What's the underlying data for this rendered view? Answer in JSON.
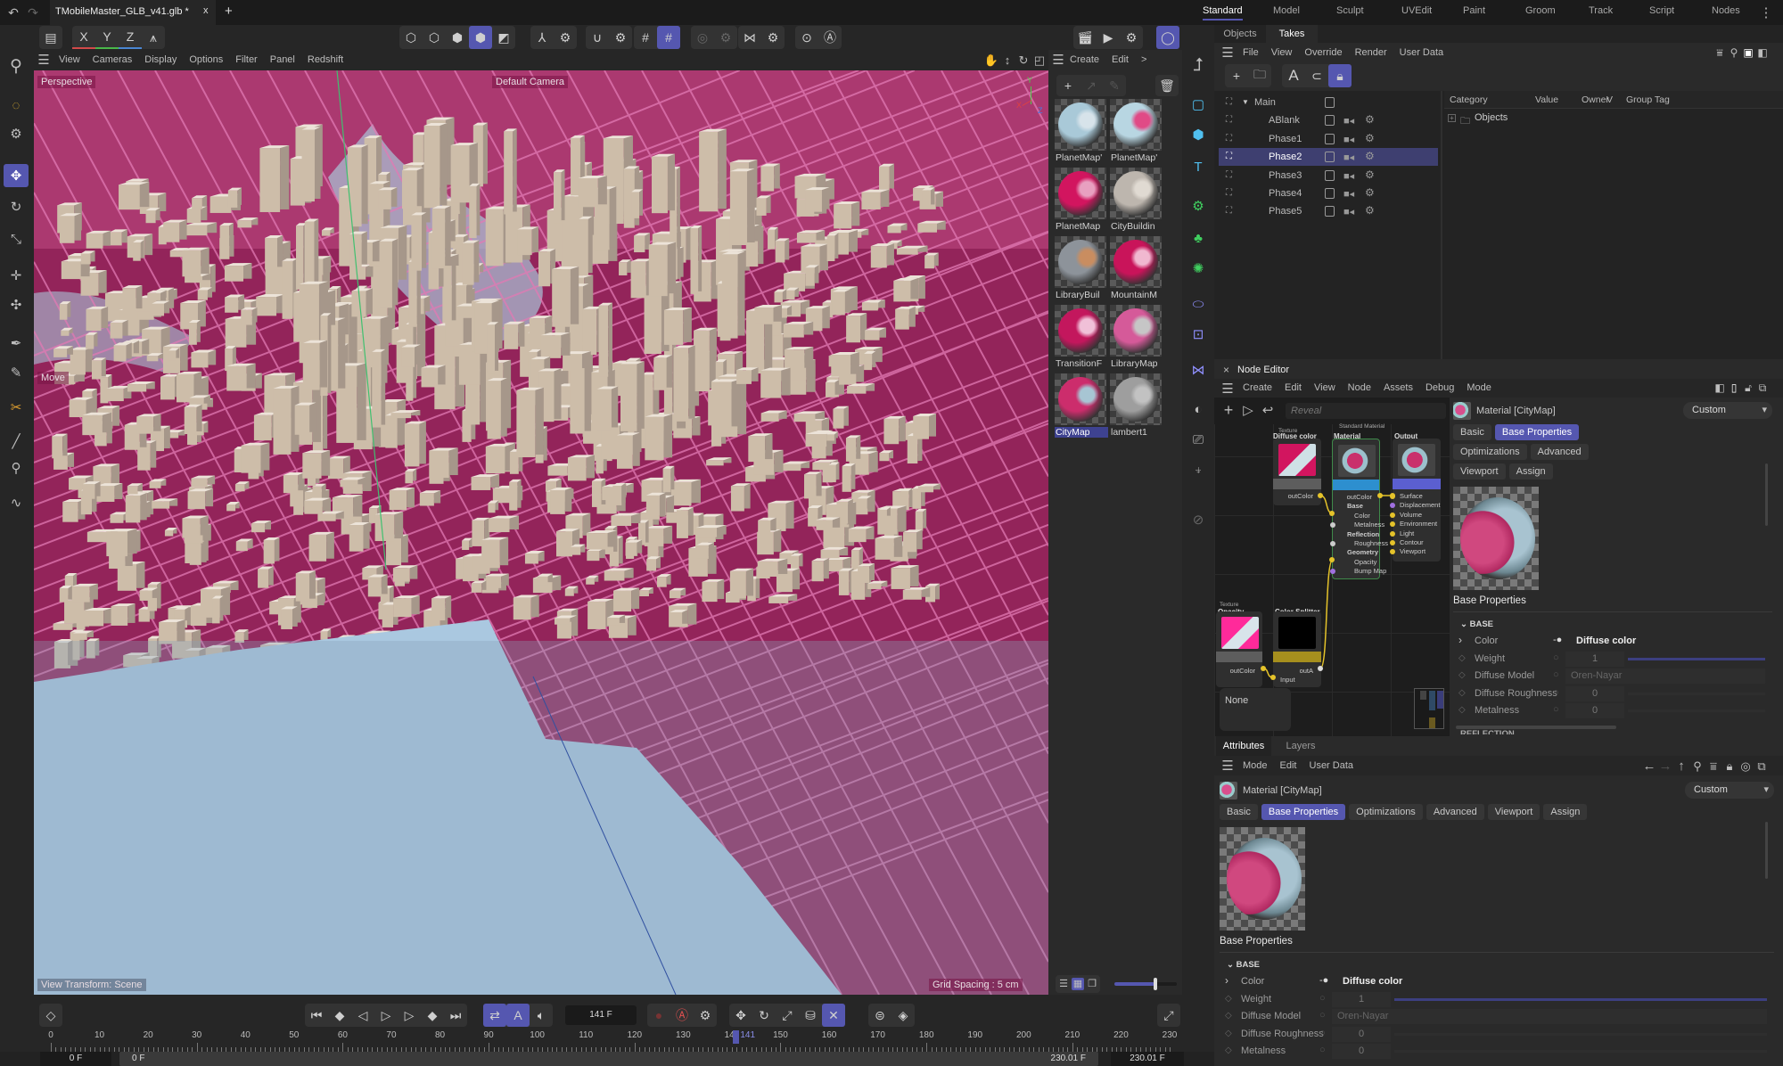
{
  "colors": {
    "accent": "#5557b0",
    "selection": "#3e3f70",
    "viewport_pink": "#9b2a5f",
    "water": "#aac8e0",
    "wire": "#e5c32a"
  },
  "titlebar": {
    "document_tab": "TMobileMaster_GLB_v41.glb *",
    "close": "x",
    "add": "+",
    "undo_icon": "undo-icon",
    "redo_icon": "redo-icon"
  },
  "layouts": [
    {
      "label": "Standard",
      "active": true
    },
    {
      "label": "Model"
    },
    {
      "label": "Sculpt"
    },
    {
      "label": "UVEdit"
    },
    {
      "label": "Paint"
    },
    {
      "label": "Groom"
    },
    {
      "label": "Track"
    },
    {
      "label": "Script"
    },
    {
      "label": "Nodes"
    }
  ],
  "toolbar": {
    "axis": [
      "X",
      "Y",
      "Z"
    ]
  },
  "viewport": {
    "menu": [
      "View",
      "Cameras",
      "Display",
      "Options",
      "Filter",
      "Panel",
      "Redshift"
    ],
    "projection": "Perspective",
    "camera": "Default Camera",
    "tool": "Move",
    "view_transform": "View Transform: Scene",
    "grid_spacing": "Grid Spacing : 5 cm",
    "axis": [
      "X",
      "Y",
      "Z"
    ]
  },
  "material_browser": {
    "menu": [
      "Create",
      "Edit",
      ">"
    ],
    "materials": [
      {
        "label": "PlanetMap'",
        "color": "#a9c9d8",
        "accent": "#d7e3ea"
      },
      {
        "label": "PlanetMap'",
        "color": "#b8d6e2",
        "accent": "#e04a86"
      },
      {
        "label": "PlanetMap",
        "color": "#d2155f",
        "accent": "#e8a0c0"
      },
      {
        "label": "CityBuildin",
        "color": "#bdb6ae",
        "accent": "#e0dad2"
      },
      {
        "label": "LibraryBuil",
        "color": "#8d939a",
        "accent": "#c98d60"
      },
      {
        "label": "MountainM",
        "color": "#c9145a",
        "accent": "#f0b8d0"
      },
      {
        "label": "TransitionF",
        "color": "#c3175d",
        "accent": "#f0c0d8"
      },
      {
        "label": "LibraryMap",
        "color": "#d55a99",
        "accent": "#c6c6c6"
      },
      {
        "label": "CityMap",
        "color": "#cc2d6c",
        "accent": "#a7c5d3",
        "selected": true
      },
      {
        "label": "lambert1",
        "color": "#9e9e9e",
        "accent": "#c2c2c2"
      }
    ]
  },
  "takes": {
    "tabs": [
      {
        "label": "Objects"
      },
      {
        "label": "Takes",
        "active": true
      }
    ],
    "menu": [
      "File",
      "View",
      "Override",
      "Render",
      "User Data"
    ],
    "items": [
      {
        "label": "Main",
        "expanded": true
      },
      {
        "label": "ABlank"
      },
      {
        "label": "Phase1"
      },
      {
        "label": "Phase2",
        "selected": true
      },
      {
        "label": "Phase3"
      },
      {
        "label": "Phase4"
      },
      {
        "label": "Phase5"
      }
    ],
    "columns": [
      "Category",
      "Value",
      "Owner",
      "V",
      "Group Tag"
    ],
    "overrides": [
      {
        "label": "Objects"
      }
    ]
  },
  "node_editor": {
    "title": "Node Editor",
    "close": "×",
    "menu": [
      "Create",
      "Edit",
      "View",
      "Node",
      "Assets",
      "Debug",
      "Mode"
    ],
    "search_placeholder": "Reveal",
    "nodes": {
      "diffuse": {
        "type": "Texture",
        "title": "Diffuse color",
        "outputs": [
          "outColor"
        ]
      },
      "material": {
        "type": "Standard Material",
        "title": "Material",
        "ports": [
          "outColor",
          "Base",
          "Color",
          "Metalness",
          "Reflection",
          "Roughness",
          "Geometry",
          "Opacity",
          "Bump Map"
        ]
      },
      "output": {
        "title": "Output",
        "ports": [
          "Surface",
          "Displacement",
          "Volume",
          "Environment",
          "Light",
          "Contour",
          "Viewport"
        ]
      },
      "opacity": {
        "type": "Texture",
        "title": "Opacity",
        "outputs": [
          "outColor"
        ]
      },
      "splitter": {
        "title": "Color Splitter",
        "outputs": [
          "outA"
        ],
        "inputs": [
          "Input"
        ]
      }
    },
    "info_box": "None"
  },
  "material_attributes": {
    "material": "Material [CityMap]",
    "mode": "Custom",
    "tabs": [
      {
        "label": "Basic"
      },
      {
        "label": "Base Properties",
        "active": true
      },
      {
        "label": "Optimizations"
      },
      {
        "label": "Advanced"
      },
      {
        "label": "Viewport"
      },
      {
        "label": "Assign"
      }
    ],
    "section_title": "Base Properties",
    "group": "BASE",
    "next_group": "REFLECTION",
    "color": {
      "label": "Color",
      "value": "Diffuse color"
    },
    "weight": {
      "label": "Weight",
      "value": "1",
      "slider": 1.0
    },
    "diffuse_model": {
      "label": "Diffuse Model",
      "value": "Oren-Nayar"
    },
    "diffuse_roughness": {
      "label": "Diffuse Roughness",
      "value": "0",
      "slider": 0
    },
    "metalness": {
      "label": "Metalness",
      "value": "0",
      "slider": 0
    }
  },
  "attributes": {
    "tabs": [
      {
        "label": "Attributes",
        "active": true
      },
      {
        "label": "Layers"
      }
    ],
    "menu": [
      "Mode",
      "Edit",
      "User Data"
    ]
  },
  "timeline": {
    "current_frame": "141 F",
    "playhead": 141,
    "ruler": [
      0,
      10,
      20,
      30,
      40,
      50,
      60,
      70,
      80,
      90,
      100,
      110,
      120,
      130,
      140,
      150,
      160,
      170,
      180,
      190,
      200,
      210,
      220,
      230
    ],
    "playhead_label": "141",
    "start": "0 F",
    "range_start": "0 F",
    "range_end": "230.01 F",
    "end": "230.01 F"
  }
}
